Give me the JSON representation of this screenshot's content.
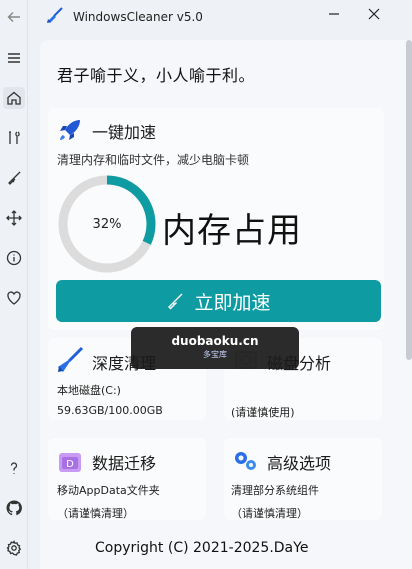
{
  "app": {
    "title": "WindowsCleaner v5.0"
  },
  "motto": "君子喻于义，小人喻于利。",
  "speed": {
    "title": "一键加速",
    "desc": "清理内存和临时文件，减少电脑卡顿",
    "memory_percent": 32,
    "memory_percent_text": "32%",
    "memory_label": "内存占用",
    "button_label": "立即加速"
  },
  "cards": {
    "deep_clean": {
      "title": "深度清理",
      "line1": "本地磁盘(C:)",
      "line2": "59.63GB/100.00GB"
    },
    "disk_analysis": {
      "title": "磁盘分析",
      "line2": "(请谨慎使用)"
    },
    "migrate": {
      "title": "数据迁移",
      "line1": "移动AppData文件夹",
      "line2": "（请谨慎清理）"
    },
    "advanced": {
      "title": "高级选项",
      "line1": "清理部分系统组件",
      "line2": "（请谨慎清理）"
    }
  },
  "watermark": {
    "main": "duobaoku.cn",
    "sub": "多宝库"
  },
  "copyright": "Copyright (C) 2021-2025.DaYe",
  "colors": {
    "accent": "#0e9ba2",
    "gauge_track": "#dcdcdc"
  },
  "icons": {
    "rail": [
      "back-icon",
      "menu-icon",
      "home-icon",
      "tools-icon",
      "broom-icon",
      "move-icon",
      "info-icon",
      "heart-icon",
      "help-icon",
      "github-icon",
      "settings-icon"
    ]
  }
}
